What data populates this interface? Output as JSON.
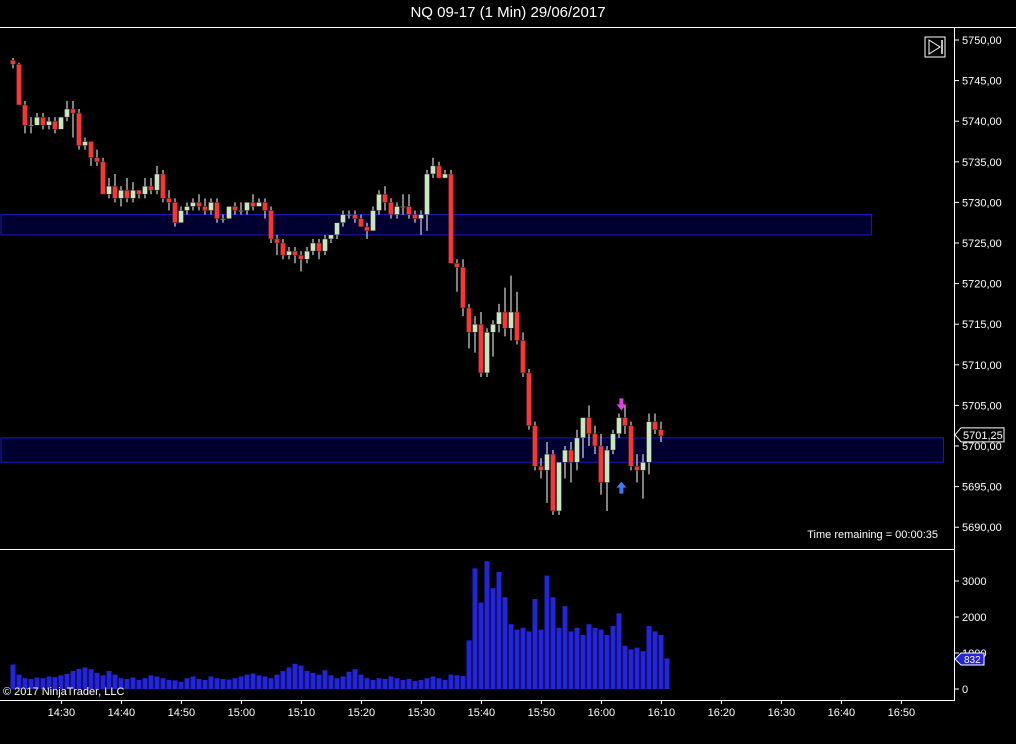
{
  "chart_data": [
    {
      "type": "candlestick",
      "title": "NQ 09-17 (1 Min)  29/06/2017",
      "x_ticks": [
        "14:30",
        "14:40",
        "14:50",
        "15:00",
        "15:10",
        "15:20",
        "15:30",
        "15:40",
        "15:50",
        "16:00",
        "16:10",
        "16:20",
        "16:30",
        "16:40",
        "16:50"
      ],
      "y_ticks": [
        "5750,00",
        "5745,00",
        "5740,00",
        "5735,00",
        "5730,00",
        "5725,00",
        "5720,00",
        "5715,00",
        "5710,00",
        "5705,00",
        "5700,00",
        "5695,00",
        "5690,00"
      ],
      "ylim": [
        5687,
        5750.5
      ],
      "last_price_label": "5701,25",
      "status_text": "Time remaining = 00:00:35",
      "zones": [
        {
          "from": 5726,
          "to": 5728.5,
          "start": "14:25",
          "end": "16:45"
        },
        {
          "from": 5698,
          "to": 5701,
          "start": "14:25",
          "end": "16:57"
        }
      ],
      "signals": [
        {
          "type": "sell-arrow",
          "time": "16:03",
          "price": 5705
        },
        {
          "type": "buy-arrow",
          "time": "16:03",
          "price": 5695
        }
      ],
      "candles": [
        [
          5747.5,
          5747.8,
          5746.5,
          5747
        ],
        [
          5747,
          5747.2,
          5742,
          5742
        ],
        [
          5742,
          5742.5,
          5738.5,
          5739.5
        ],
        [
          5739.5,
          5740.5,
          5738.5,
          5739.5
        ],
        [
          5739.5,
          5741,
          5739.5,
          5740.5
        ],
        [
          5740.5,
          5741,
          5739,
          5739.5
        ],
        [
          5739.5,
          5740.5,
          5739,
          5740
        ],
        [
          5740,
          5740.5,
          5738.5,
          5739
        ],
        [
          5739,
          5740.5,
          5739,
          5740.5
        ],
        [
          5740.5,
          5742.5,
          5740,
          5741.5
        ],
        [
          5741.5,
          5742.5,
          5738,
          5741
        ],
        [
          5741,
          5741.5,
          5736.5,
          5737
        ],
        [
          5737,
          5738,
          5736.5,
          5737.5
        ],
        [
          5737.5,
          5736,
          5734.5,
          5735.5
        ],
        [
          5735.5,
          5736.5,
          5734.5,
          5735
        ],
        [
          5735,
          5735.5,
          5731,
          5731
        ],
        [
          5731,
          5733,
          5730.5,
          5732
        ],
        [
          5732,
          5733.5,
          5730,
          5730.5
        ],
        [
          5730.5,
          5732,
          5729.5,
          5731.5
        ],
        [
          5731.5,
          5733,
          5730,
          5730.5
        ],
        [
          5730.5,
          5732.5,
          5730,
          5731.5
        ],
        [
          5731.5,
          5731.5,
          5730.5,
          5731
        ],
        [
          5731,
          5733,
          5730.5,
          5732
        ],
        [
          5732,
          5733,
          5731,
          5731.5
        ],
        [
          5731.5,
          5734.5,
          5731,
          5733.5
        ],
        [
          5733.5,
          5734,
          5730,
          5730.5
        ],
        [
          5730.5,
          5731.5,
          5729,
          5730
        ],
        [
          5730,
          5730.5,
          5727,
          5727.5
        ],
        [
          5727.5,
          5729.5,
          5727.5,
          5729
        ],
        [
          5729,
          5730,
          5728.5,
          5729.5
        ],
        [
          5729.5,
          5730.5,
          5729,
          5730
        ],
        [
          5730,
          5731,
          5729,
          5729.5
        ],
        [
          5729.5,
          5730.5,
          5728.5,
          5729
        ],
        [
          5729,
          5730.5,
          5728.5,
          5730
        ],
        [
          5730,
          5730.5,
          5727.5,
          5728
        ],
        [
          5728,
          5728.5,
          5727.5,
          5728
        ],
        [
          5728,
          5729.5,
          5728,
          5729.5
        ],
        [
          5729.5,
          5730,
          5728.5,
          5729
        ],
        [
          5729,
          5730,
          5728.5,
          5729
        ],
        [
          5729,
          5730,
          5728.5,
          5730
        ],
        [
          5730,
          5731,
          5729,
          5729.5
        ],
        [
          5729.5,
          5730.5,
          5729.5,
          5730
        ],
        [
          5730,
          5730.5,
          5728,
          5729
        ],
        [
          5729,
          5729.5,
          5725,
          5725.5
        ],
        [
          5725.5,
          5726,
          5723.5,
          5725
        ],
        [
          5725,
          5725.5,
          5723,
          5723.5
        ],
        [
          5723.5,
          5724.5,
          5723,
          5724
        ],
        [
          5724,
          5724.5,
          5722.5,
          5723.5
        ],
        [
          5723.5,
          5724,
          5721.5,
          5723
        ],
        [
          5723,
          5724.5,
          5722.5,
          5724
        ],
        [
          5724,
          5725.5,
          5723.5,
          5725
        ],
        [
          5725,
          5725.5,
          5723,
          5724
        ],
        [
          5724,
          5726,
          5723.5,
          5725.5
        ],
        [
          5725.5,
          5726,
          5725,
          5726
        ],
        [
          5726,
          5727.5,
          5725.5,
          5727.5
        ],
        [
          5727.5,
          5729,
          5727,
          5728.5
        ],
        [
          5728.5,
          5729,
          5728,
          5728.5
        ],
        [
          5728.5,
          5729,
          5727.5,
          5728
        ],
        [
          5728,
          5728.5,
          5727,
          5727
        ],
        [
          5727,
          5727.5,
          5725.5,
          5726.5
        ],
        [
          5726.5,
          5729.5,
          5726.5,
          5729
        ],
        [
          5729,
          5731.5,
          5728.5,
          5731
        ],
        [
          5731,
          5732,
          5729,
          5730
        ],
        [
          5730,
          5730.5,
          5728,
          5728.5
        ],
        [
          5728.5,
          5730,
          5728,
          5729.5
        ],
        [
          5729.5,
          5731,
          5728.5,
          5729.5
        ],
        [
          5729.5,
          5731,
          5728,
          5728.5
        ],
        [
          5728.5,
          5729,
          5727.5,
          5728
        ],
        [
          5728,
          5729,
          5726,
          5728.5
        ],
        [
          5728.5,
          5734,
          5726.5,
          5733.5
        ],
        [
          5733.5,
          5735.5,
          5733,
          5734.5
        ],
        [
          5734.5,
          5735,
          5733,
          5733
        ],
        [
          5733,
          5734,
          5733,
          5733.5
        ],
        [
          5733.5,
          5734,
          5726,
          5722.5
        ],
        [
          5722.5,
          5723,
          5719,
          5722
        ],
        [
          5722,
          5723,
          5716,
          5717
        ],
        [
          5717,
          5717.5,
          5712,
          5714
        ],
        [
          5714,
          5716,
          5711.5,
          5715
        ],
        [
          5715,
          5716.5,
          5708.5,
          5709
        ],
        [
          5709,
          5714.5,
          5708.5,
          5714
        ],
        [
          5714,
          5715.5,
          5711,
          5715
        ],
        [
          5715,
          5717.5,
          5714,
          5716.5
        ],
        [
          5716.5,
          5719.5,
          5713.5,
          5714.5
        ],
        [
          5714.5,
          5721,
          5713,
          5716.5
        ],
        [
          5716.5,
          5719,
          5712.5,
          5713
        ],
        [
          5713,
          5714,
          5708.5,
          5709
        ],
        [
          5709,
          5709.5,
          5702,
          5702.5
        ],
        [
          5702.5,
          5703,
          5697,
          5697.5
        ],
        [
          5697.5,
          5698.5,
          5696,
          5697
        ],
        [
          5697,
          5700.5,
          5693,
          5699
        ],
        [
          5699,
          5699.5,
          5691.5,
          5692
        ],
        [
          5692,
          5698,
          5691.5,
          5698
        ],
        [
          5698,
          5700,
          5696,
          5699.5
        ],
        [
          5699.5,
          5700.5,
          5695.5,
          5698
        ],
        [
          5698,
          5702,
          5697,
          5701
        ],
        [
          5701,
          5703.5,
          5698.5,
          5703.5
        ],
        [
          5703.5,
          5705,
          5700,
          5701.5
        ],
        [
          5701.5,
          5702.5,
          5699,
          5700
        ],
        [
          5700,
          5701.5,
          5694,
          5695.5
        ],
        [
          5695.5,
          5700,
          5692,
          5699.5
        ],
        [
          5699.5,
          5702,
          5699,
          5701.5
        ],
        [
          5701.5,
          5704,
          5701,
          5703.5
        ],
        [
          5703.5,
          5705,
          5701.5,
          5702.5
        ],
        [
          5702.5,
          5703,
          5697,
          5697.5
        ],
        [
          5697.5,
          5699,
          5695.5,
          5697
        ],
        [
          5697,
          5699,
          5693.5,
          5698
        ],
        [
          5698,
          5704,
          5696.5,
          5703
        ],
        [
          5703,
          5704,
          5701.5,
          5702
        ],
        [
          5702,
          5703,
          5700.5,
          5701.25
        ]
      ],
      "volume": {
        "y_ticks": [
          "3000",
          "2000",
          "1000",
          "0"
        ],
        "ylim": [
          0,
          3500
        ],
        "last_volume_label": "832",
        "values": [
          680,
          400,
          300,
          280,
          320,
          300,
          350,
          330,
          380,
          420,
          500,
          560,
          600,
          550,
          450,
          380,
          500,
          400,
          300,
          280,
          320,
          250,
          300,
          380,
          350,
          300,
          250,
          240,
          200,
          300,
          350,
          280,
          250,
          350,
          300,
          280,
          260,
          300,
          350,
          400,
          430,
          380,
          350,
          300,
          400,
          500,
          600,
          700,
          650,
          500,
          450,
          400,
          520,
          380,
          300,
          350,
          480,
          550,
          400,
          300,
          250,
          300,
          280,
          350,
          300,
          250,
          280,
          220,
          250,
          300,
          350,
          300,
          250,
          400,
          380,
          360,
          1350,
          3350,
          2400,
          3550,
          2800,
          3250,
          2550,
          1800,
          1650,
          1700,
          1600,
          2500,
          1650,
          3150,
          2550,
          1700,
          2300,
          1600,
          1700,
          1500,
          1800,
          1700,
          1650,
          1500,
          1750,
          2100,
          1200,
          1100,
          1150,
          1050,
          1750,
          1600,
          1500,
          850
        ]
      }
    }
  ],
  "copyright": "© 2017 NinjaTrader, LLC",
  "colors": {
    "background": "#000000",
    "up_candle": "#c8e6c0",
    "down_candle": "#ff3333",
    "zone": "#1a1ac8",
    "volume": "#2424d8",
    "sell_arrow": "#e040e0",
    "buy_arrow": "#3a7bff"
  }
}
